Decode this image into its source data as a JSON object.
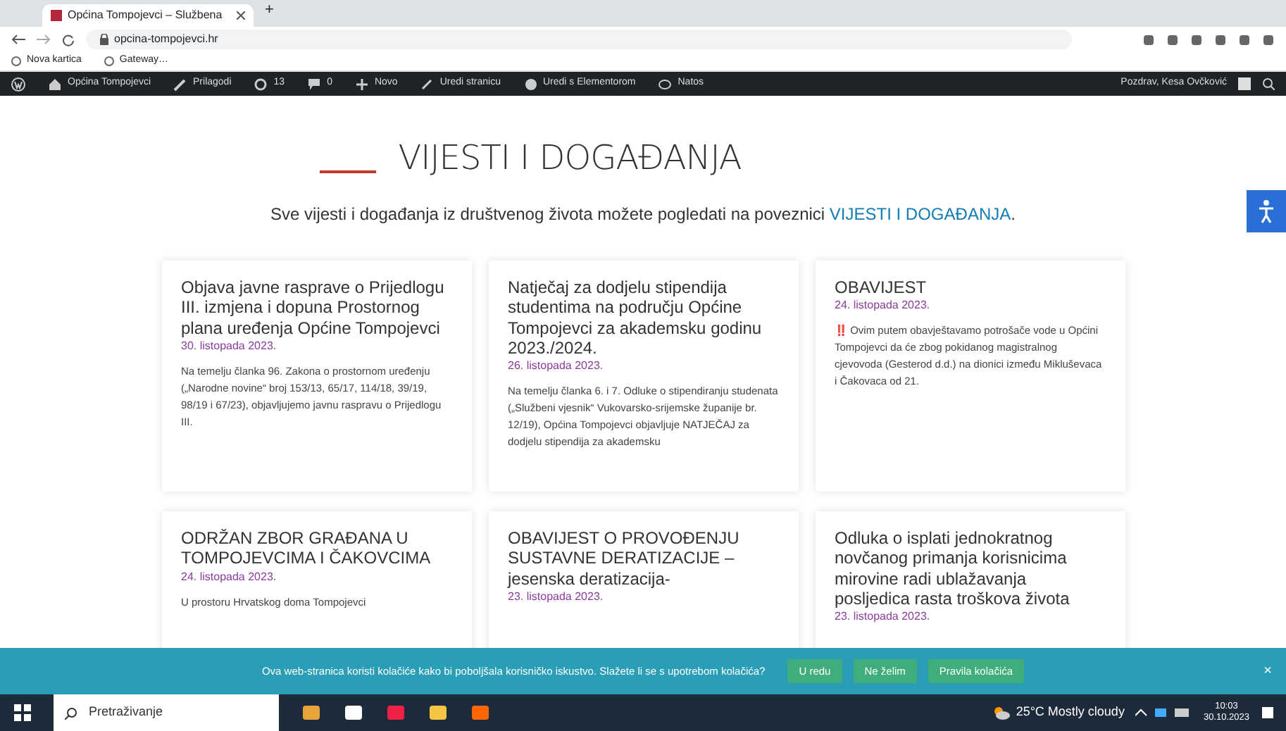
{
  "browser": {
    "tab_title": "Općina Tompojevci – Službena",
    "new_tab": "+",
    "url": "opcina-tompojevci.hr",
    "bookmarks": [
      "Nova kartica",
      "Gateway…"
    ]
  },
  "admin_bar": {
    "items": [
      {
        "kind": "site",
        "label": "Općina Tompojevci"
      },
      {
        "kind": "customize",
        "label": "Prilagodi"
      },
      {
        "kind": "updates",
        "label": "13"
      },
      {
        "kind": "comments",
        "label": "0"
      },
      {
        "kind": "new",
        "label": "Novo"
      },
      {
        "kind": "edit",
        "label": "Uredi stranicu"
      },
      {
        "kind": "elementor",
        "label": "Uredi s Elementorom"
      },
      {
        "kind": "notes",
        "label": "Natos"
      }
    ],
    "greeting": "Pozdrav, Kesa Ovčković"
  },
  "page": {
    "title": "VIJESTI I DOGAĐANJA",
    "intro": "Sve vijesti i događanja iz društvenog života možete pogledati na poveznici ",
    "intro_link": "VIJESTI I DOGAĐANJA",
    "intro_end": "."
  },
  "posts": [
    {
      "title": "Objava javne rasprave o Prijedlogu III. izmjena i dopuna Prostornog plana uređenja Općine Tompojevci",
      "date": "30. listopada 2023.",
      "excerpt": "Na temelju članka 96. Zakona o prostornom uređenju („Narodne novine“ broj 153/13, 65/17, 114/18, 39/19, 98/19 i 67/23), objavljujemo javnu raspravu o Prijedlogu III."
    },
    {
      "title": "Natječaj za dodjelu stipendija studentima na području Općine Tompojevci za akademsku godinu 2023./2024.",
      "date": "26. listopada 2023.",
      "excerpt": "Na temelju članka 6. i 7. Odluke o stipendiranju studenata („Službeni vjesnik“ Vukovarsko-srijemske županije br. 12/19), Općina Tompojevci objavljuje NATJEČAJ za dodjelu stipendija za akademsku"
    },
    {
      "title": "OBAVIJEST",
      "date": "24. listopada 2023.",
      "excerpt": "**‼️** Ovim putem obavještavamo potrošače vode u Općini Tompojevci da će zbog pokidanog magistralnog cjevovoda (Gesterod d.d.) na dionici između Mikluševaca i Čakovaca od 21."
    },
    {
      "title": "ODRŽAN ZBOR GRAĐANA U TOMPOJEVCIMA I ČAKOVCIMA",
      "date": "24. listopada 2023.",
      "excerpt": "U prostoru Hrvatskog doma Tompojevci"
    },
    {
      "title": "OBAVIJEST O PROVOĐENJU SUSTAVNE DERATIZACIJE – jesenska deratizacija-",
      "date": "23. listopada 2023."
    },
    {
      "title": "Odluka o isplati jednokratnog novčanog primanja korisnicima mirovine radi ublažavanja posljedica rasta troškova života",
      "date": "23. listopada 2023."
    }
  ],
  "cookie_banner": {
    "text": "Ova web-stranica koristi kolačiće kako bi poboljšala korisničko iskustvo. Slažete li se s upotrebom kolačića?",
    "buttons": [
      "U redu",
      "Ne želim",
      "Pravila kolačića"
    ],
    "close": "×"
  },
  "taskbar": {
    "search": "Pretraživanje",
    "weather": "25°C Mostly cloudy",
    "time": "10:03",
    "date": "30.10.2023"
  }
}
